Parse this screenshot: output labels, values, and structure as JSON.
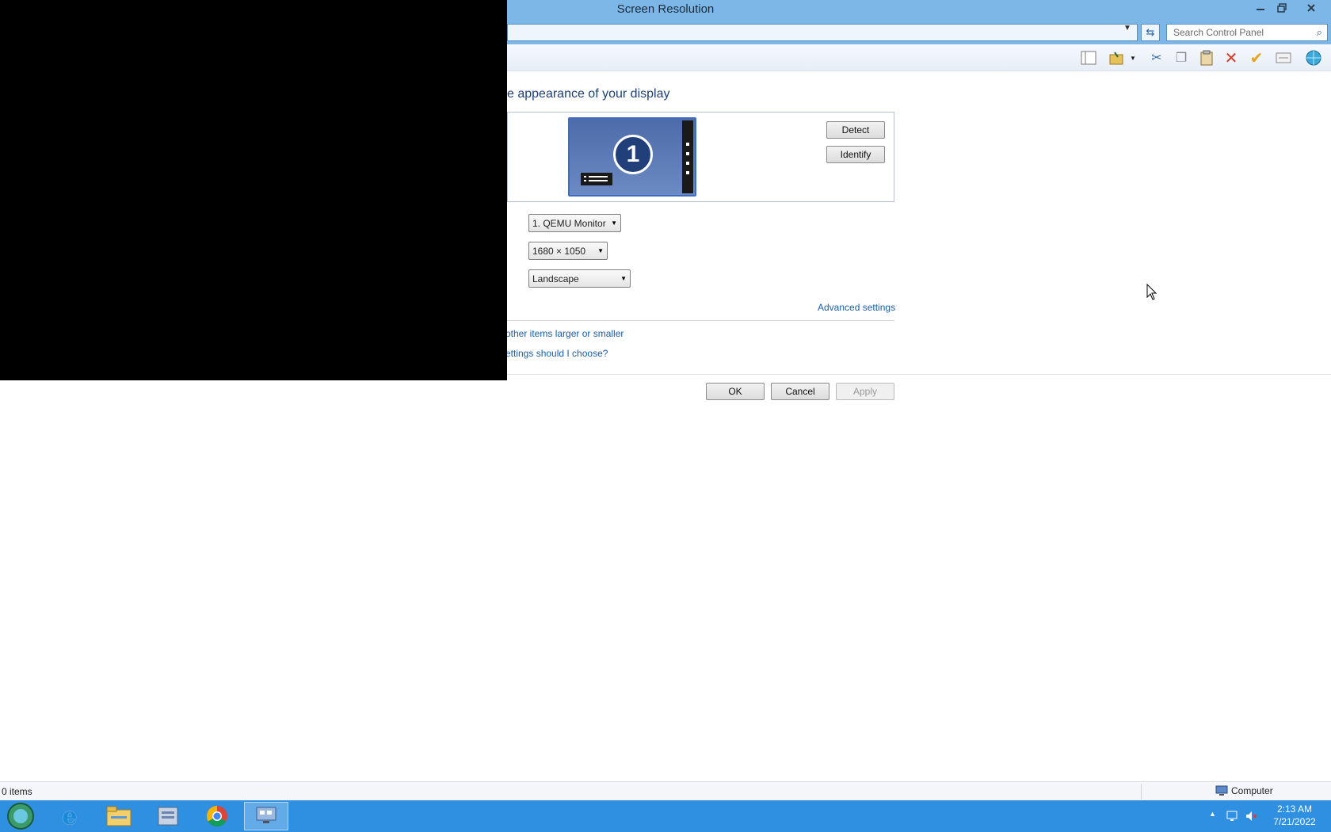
{
  "window": {
    "title": "Screen Resolution",
    "search_placeholder": "Search Control Panel"
  },
  "content": {
    "heading": "e appearance of your display",
    "monitor_number": "1",
    "detect_label": "Detect",
    "identify_label": "Identify",
    "display_select": "1. QEMU Monitor",
    "resolution_select": "1680 × 1050",
    "orientation_select": "Landscape",
    "advanced_link": "Advanced settings",
    "larger_smaller_link": "other items larger or smaller",
    "which_settings_link": "ettings should I choose?",
    "ok_label": "OK",
    "cancel_label": "Cancel",
    "apply_label": "Apply"
  },
  "statusbar": {
    "items_count": "0 items",
    "location": "Computer"
  },
  "taskbar": {
    "time": "2:13 AM",
    "date": "7/21/2022"
  },
  "colors": {
    "title_bar": "#7db7e8",
    "taskbar": "#2f8fe0",
    "link": "#1a5ea8"
  }
}
